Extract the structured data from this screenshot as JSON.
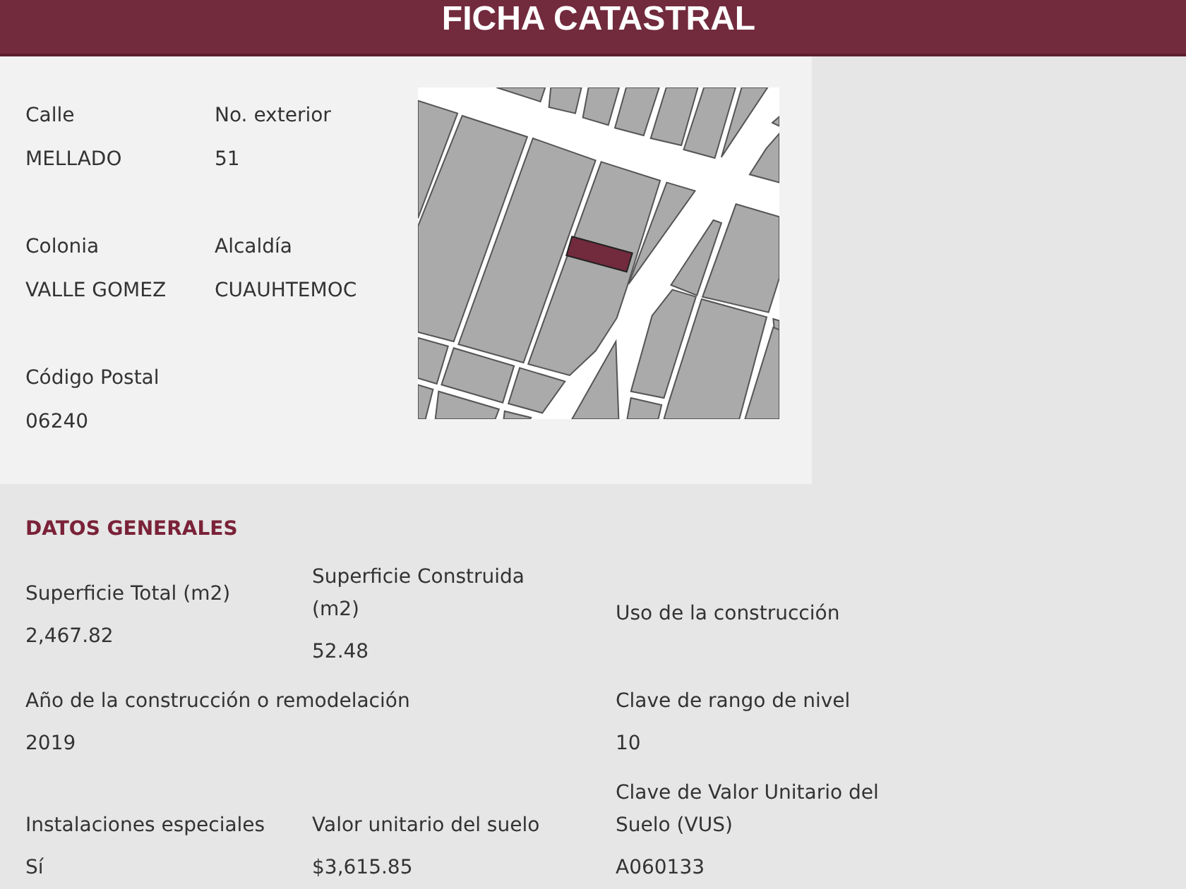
{
  "header": {
    "title": "FICHA CATASTRAL"
  },
  "location": {
    "fields": [
      {
        "label": "Calle",
        "value": "MELLADO"
      },
      {
        "label": "No. exterior",
        "value": "51"
      },
      {
        "label": "Colonia",
        "value": "VALLE GOMEZ"
      },
      {
        "label": "Alcaldía",
        "value": "CUAUHTEMOC"
      },
      {
        "label": "Código Postal",
        "value": "06240"
      }
    ]
  },
  "datos_generales": {
    "title": "DATOS GENERALES",
    "rows": [
      [
        {
          "label": "Superficie Total (m2)",
          "value": "2,467.82"
        },
        {
          "label": "Superficie Construida (m2)",
          "value": "52.48"
        },
        {
          "label": "Uso de la construcción"
        }
      ],
      [
        {
          "label": "Año de la construcción o remodelación",
          "value": "2019"
        },
        "",
        {
          "label": "Clave de rango de nivel",
          "value": "10"
        }
      ],
      [
        {
          "label": "Instalaciones especiales",
          "value": "Sí"
        },
        {
          "label": "Valor unitario del suelo",
          "value": "$3,615.85"
        },
        {
          "label": "Clave de Valor Unitario del Suelo (VUS)",
          "value": "A060133"
        }
      ]
    ]
  }
}
